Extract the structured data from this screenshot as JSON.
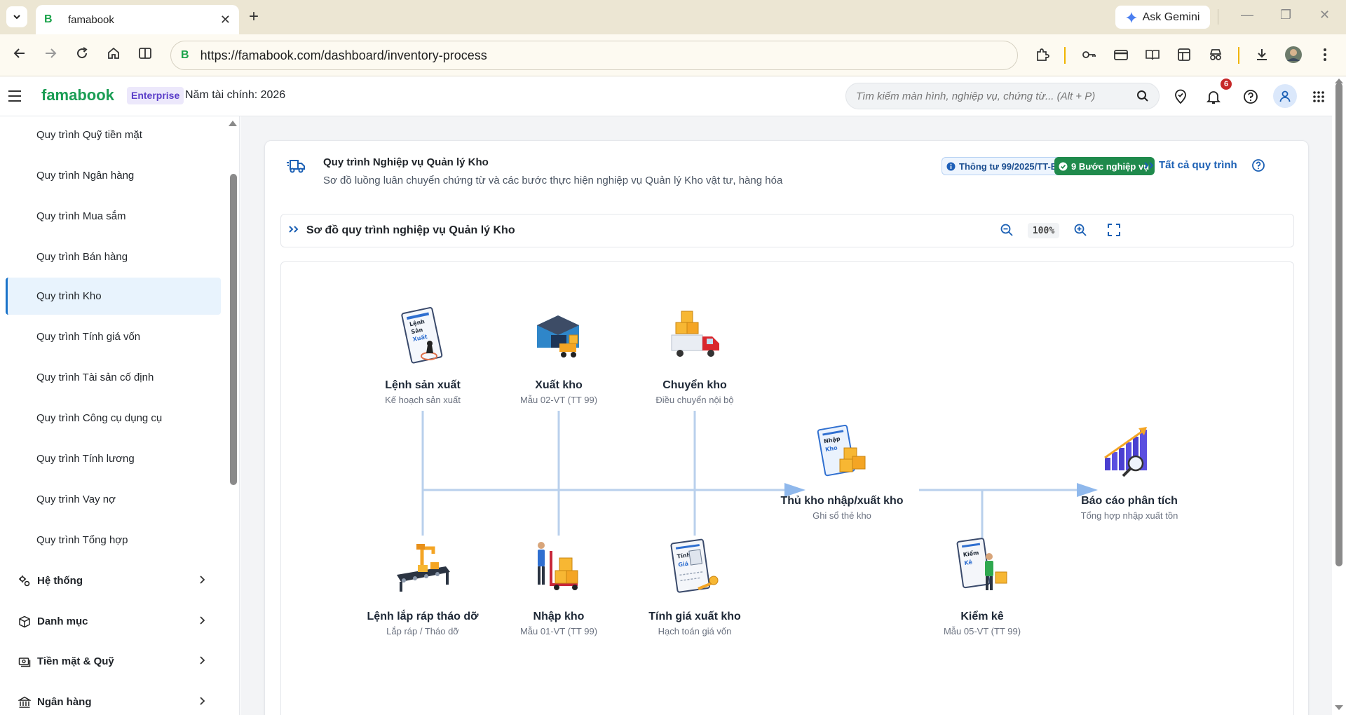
{
  "browser": {
    "tab_title": "famabook",
    "url": "https://famabook.com/dashboard/inventory-process",
    "gemini_label": "Ask Gemini"
  },
  "header": {
    "logo": "famabook",
    "plan_badge": "Enterprise",
    "fiscal_year": "Năm tài chính: 2026",
    "search_placeholder": "Tìm kiếm màn hình, nghiệp vụ, chứng từ... (Alt + P)",
    "notification_count": "6"
  },
  "sidebar": {
    "items": [
      {
        "label": "Quy trình Quỹ tiền mặt"
      },
      {
        "label": "Quy trình Ngân hàng"
      },
      {
        "label": "Quy trình Mua sắm"
      },
      {
        "label": "Quy trình Bán hàng"
      },
      {
        "label": "Quy trình Kho"
      },
      {
        "label": "Quy trình Tính giá vốn"
      },
      {
        "label": "Quy trình Tài sản cố định"
      },
      {
        "label": "Quy trình Công cụ dụng cụ"
      },
      {
        "label": "Quy trình Tính lương"
      },
      {
        "label": "Quy trình Vay nợ"
      },
      {
        "label": "Quy trình Tổng hợp"
      }
    ],
    "active_index": 4,
    "groups": [
      {
        "label": "Hệ thống",
        "icon": "gears-icon"
      },
      {
        "label": "Danh mục",
        "icon": "cube-icon"
      },
      {
        "label": "Tiền mặt & Quỹ",
        "icon": "cash-icon"
      },
      {
        "label": "Ngân hàng",
        "icon": "bank-icon"
      }
    ]
  },
  "page": {
    "title": "Quy trình Nghiệp vụ Quản lý Kho",
    "subtitle": "Sơ đồ luồng luân chuyển chứng từ và các bước thực hiện nghiệp vụ Quản lý Kho vật tư, hàng hóa",
    "circular_badge": "Thông tư 99/2025/TT-BTC",
    "steps_badge": "9 Bước nghiệp vụ",
    "all_processes_link": "Tất cả quy trình"
  },
  "diagram": {
    "title": "Sơ đồ quy trình nghiệp vụ Quản lý Kho",
    "zoom": "100%",
    "nodes": [
      {
        "title": "Lệnh sản xuất",
        "subtitle": "Kế hoạch sản xuất",
        "icon": "production-order-icon"
      },
      {
        "title": "Xuất kho",
        "subtitle": "Mẫu 02-VT (TT 99)",
        "icon": "warehouse-out-icon"
      },
      {
        "title": "Chuyển kho",
        "subtitle": "Điều chuyển nội bộ",
        "icon": "transfer-truck-icon"
      },
      {
        "title": "Thủ kho nhập/xuất kho",
        "subtitle": "Ghi sổ thẻ kho",
        "icon": "stock-card-icon"
      },
      {
        "title": "Báo cáo phân tích",
        "subtitle": "Tổng hợp nhập xuất tồn",
        "icon": "analysis-chart-icon"
      },
      {
        "title": "Lệnh lắp ráp tháo dỡ",
        "subtitle": "Lắp ráp / Tháo dỡ",
        "icon": "assembly-line-icon"
      },
      {
        "title": "Nhập kho",
        "subtitle": "Mẫu 01-VT (TT 99)",
        "icon": "warehouse-in-icon"
      },
      {
        "title": "Tính giá xuất kho",
        "subtitle": "Hạch toán giá vốn",
        "icon": "costing-doc-icon"
      },
      {
        "title": "Kiểm kê",
        "subtitle": "Mẫu 05-VT (TT 99)",
        "icon": "stocktake-icon"
      }
    ],
    "doc_labels": {
      "lsx": [
        "Lệnh",
        "Sản",
        "Xuất"
      ],
      "nk": [
        "Nhập",
        "Kho"
      ],
      "tg": [
        "Tính",
        "Giá"
      ],
      "kk": [
        "Kiểm",
        "Kê"
      ]
    }
  },
  "colors": {
    "brand": "#1a9d54",
    "accent": "#1a73c9",
    "flow_line": "#b9d0ec",
    "arrow": "#8fb8ec"
  }
}
